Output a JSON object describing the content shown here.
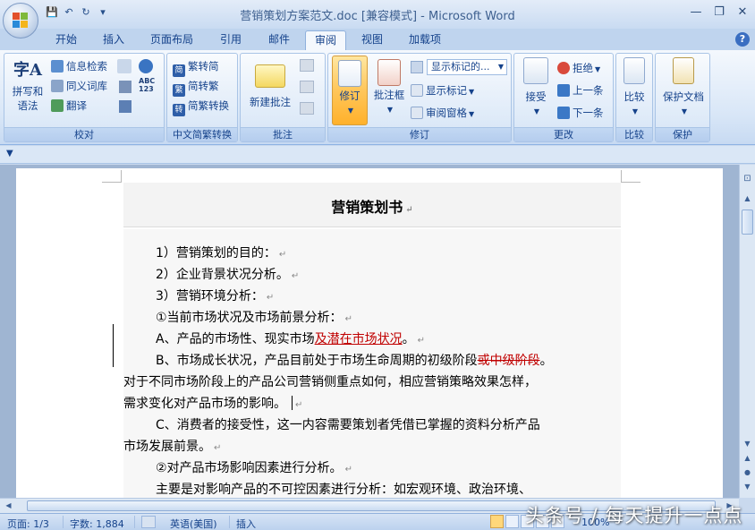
{
  "window": {
    "title": "营销策划方案范文.doc [兼容模式] - Microsoft Word",
    "minimize": "—",
    "restore": "❐",
    "close": "✕"
  },
  "qat": {
    "save": "💾",
    "undo": "↶",
    "redo": "↻",
    "more": "▾"
  },
  "tabs": [
    {
      "label": "开始"
    },
    {
      "label": "插入"
    },
    {
      "label": "页面布局"
    },
    {
      "label": "引用"
    },
    {
      "label": "邮件"
    },
    {
      "label": "审阅",
      "active": true
    },
    {
      "label": "视图"
    },
    {
      "label": "加载项"
    }
  ],
  "help": "?",
  "ribbon": {
    "proofing": {
      "label": "校对",
      "spell_check": "拼写和语法",
      "spell_line1": "拼写和",
      "spell_line2": "语法",
      "research": "信息检索",
      "thesaurus": "同义词库",
      "translate": "翻译"
    },
    "chinese": {
      "label": "中文简繁转换",
      "to_simplified": "繁转简",
      "to_traditional": "简转繁",
      "convert": "简繁转换"
    },
    "comments": {
      "label": "批注",
      "new_comment": "新建批注"
    },
    "tracking": {
      "label": "修订",
      "track_changes": "修订",
      "balloons": "批注框",
      "markup_combo": "显示标记的...",
      "show_markup": "显示标记",
      "review_pane": "审阅窗格"
    },
    "changes": {
      "label": "更改",
      "accept": "接受",
      "reject": "拒绝",
      "previous": "上一条",
      "next": "下一条"
    },
    "compare": {
      "label": "比较",
      "compare": "比较"
    },
    "protect": {
      "label": "保护",
      "protect_doc": "保护文档"
    }
  },
  "document": {
    "title": "营销策划书",
    "paragraphs": {
      "p1": "1）营销策划的目的：",
      "p2": "2）企业背景状况分析。",
      "p3": "3）营销环境分析：",
      "p4": "①当前市场状况及市场前景分析：",
      "p5_text": "A、产品的市场性、现实市场",
      "p5_ins": "及潜在市场状况",
      "p5_end": "。",
      "p6_text": "B、市场成长状况，产品目前处于市场生命周期的初级阶段",
      "p6_del": "或中级阶段",
      "p6_end": "。",
      "p7": "对于不同市场阶段上的产品公司营销侧重点如何，相应营销策略效果怎样，",
      "p8": "需求变化对产品市场的影响。",
      "p9": "C、消费者的接受性，这一内容需要策划者凭借已掌握的资料分析产品",
      "p10": "市场发展前景。",
      "p11": "②对产品市场影响因素进行分析。",
      "p12": "主要是对影响产品的不可控因素进行分析：如宏观环境、政治环境、"
    },
    "para_mark": "↵"
  },
  "statusbar": {
    "page": "页面: 1/3",
    "words": "字数: 1,884",
    "language": "英语(美国)",
    "mode": "插入",
    "zoom": "100%"
  },
  "watermark": "头条号 / 每天提升一点点",
  "colors": {
    "revision": "#c00000",
    "accent": "#15428b"
  }
}
